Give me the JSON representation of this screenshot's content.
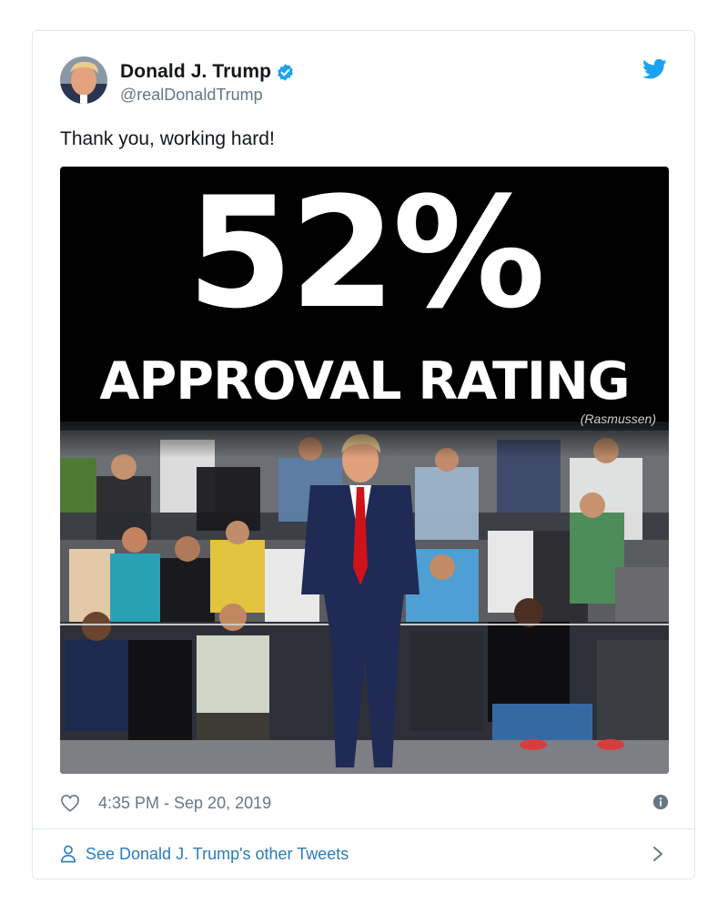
{
  "tweet": {
    "author_name": "Donald J. Trump",
    "author_handle": "@realDonaldTrump",
    "text": "Thank you, working hard!",
    "media": {
      "headline": "52%",
      "subhead": "APPROVAL RATING",
      "source": "(Rasmussen)"
    },
    "timestamp": "4:35 PM - Sep 20, 2019",
    "footer_link": "See Donald J. Trump's other Tweets"
  },
  "colors": {
    "brand_blue": "#1da1f2",
    "link_blue": "#2b7bb9",
    "muted_gray": "#657786",
    "tie_red": "#d0121b"
  },
  "icons": {
    "verified": "verified-badge-icon",
    "twitter": "twitter-bird-icon",
    "like": "heart-icon",
    "info": "info-icon",
    "profile": "person-icon",
    "next": "chevron-right-icon"
  }
}
